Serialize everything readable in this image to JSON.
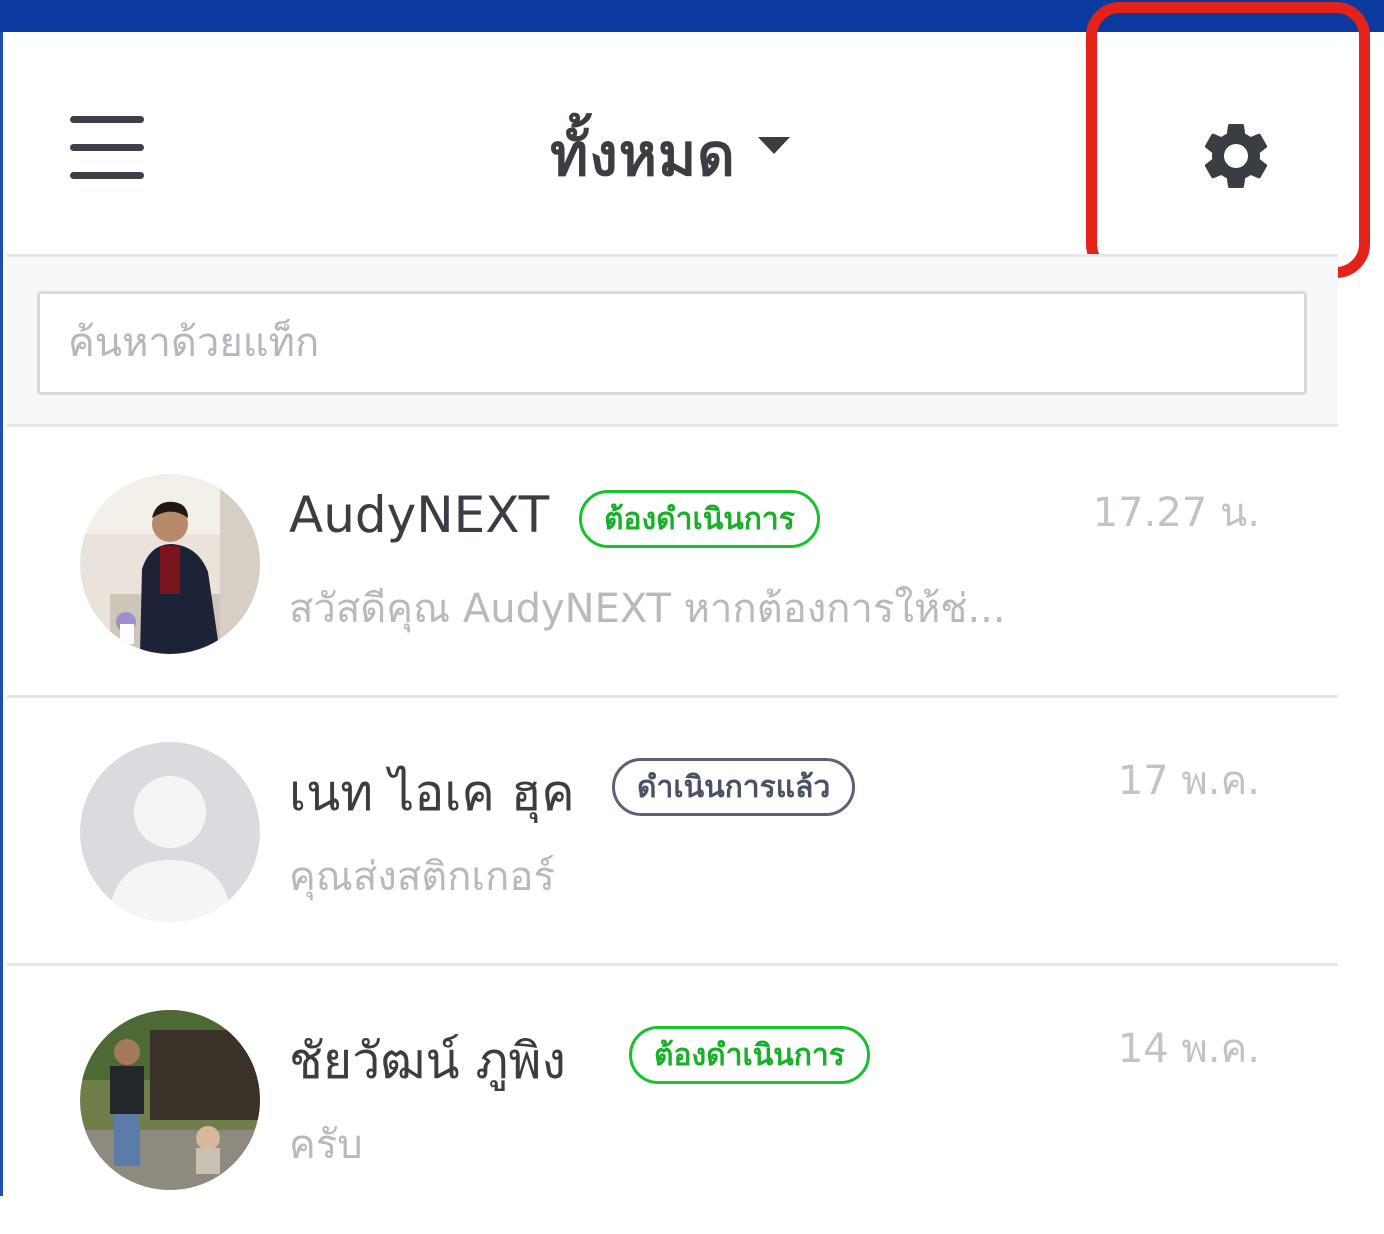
{
  "header": {
    "title": "ทั้งหมด"
  },
  "search": {
    "placeholder": "ค้นหาด้วยแท็ก"
  },
  "colors": {
    "top_strip": "#0a3a9e",
    "highlight": "#e4221a",
    "badge_pending": "#18c12e",
    "badge_done": "#5a6275"
  },
  "chats": [
    {
      "name": "AudyNEXT",
      "status": "ต้องดำเนินการ",
      "preview": "สวัสดีคุณ AudyNEXT หากต้องการให้ช่...",
      "time": "17.27 น.",
      "avatar": "photo-man-in-suit"
    },
    {
      "name": "เนท ไอเค ฮุค",
      "status": "ดำเนินการแล้ว",
      "preview": "คุณส่งสติกเกอร์",
      "time": "17 พ.ค.",
      "avatar": "default-person-silhouette"
    },
    {
      "name": "ชัยวัฒน์ ภูพิง",
      "status": "ต้องดำเนินการ",
      "preview": "ครับ",
      "time": "14 พ.ค.",
      "avatar": "photo-man-with-child-outdoors"
    }
  ]
}
